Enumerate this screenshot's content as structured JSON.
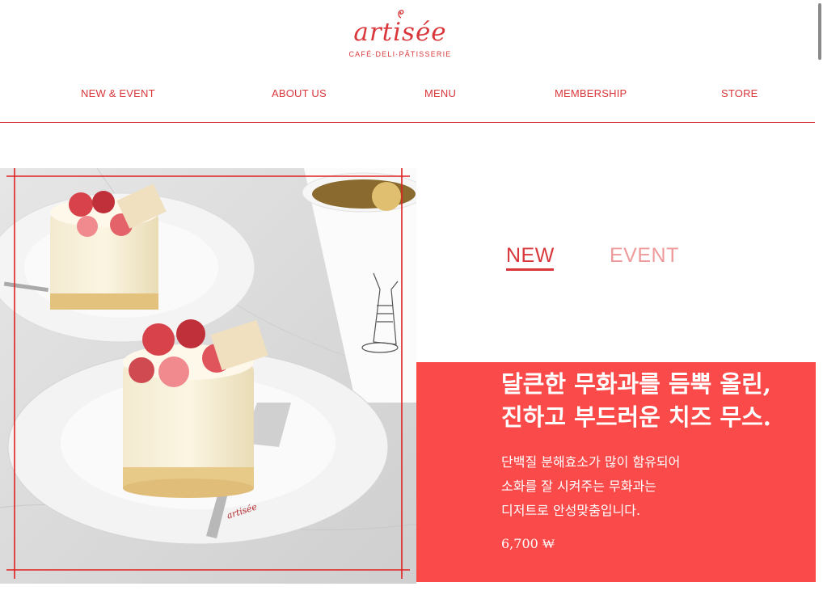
{
  "brand": {
    "logo_text": "artisée",
    "tagline": "CAFÉ·DELI·PÂTISSERIE",
    "accent_color": "#d9373b"
  },
  "nav": {
    "items": [
      {
        "label": "NEW & EVENT"
      },
      {
        "label": "ABOUT US"
      },
      {
        "label": "MENU"
      },
      {
        "label": "MEMBERSHIP"
      },
      {
        "label": "STORE"
      }
    ]
  },
  "feature": {
    "image_logo_text": "artisée",
    "tabs": [
      {
        "label": "NEW",
        "active": true
      },
      {
        "label": "EVENT",
        "active": false
      }
    ],
    "headline_lines": [
      "달큰한 무화과를 듬뿍 올린,",
      "진하고 부드러운 치즈 무스."
    ],
    "description_lines": [
      "단백질 분해효소가 많이 함유되어",
      "소화를 잘 시켜주는 무화과는",
      "디저트로 안성맞춤입니다."
    ],
    "price": "6,700 ₩",
    "panel_color": "#fa4a4a"
  }
}
